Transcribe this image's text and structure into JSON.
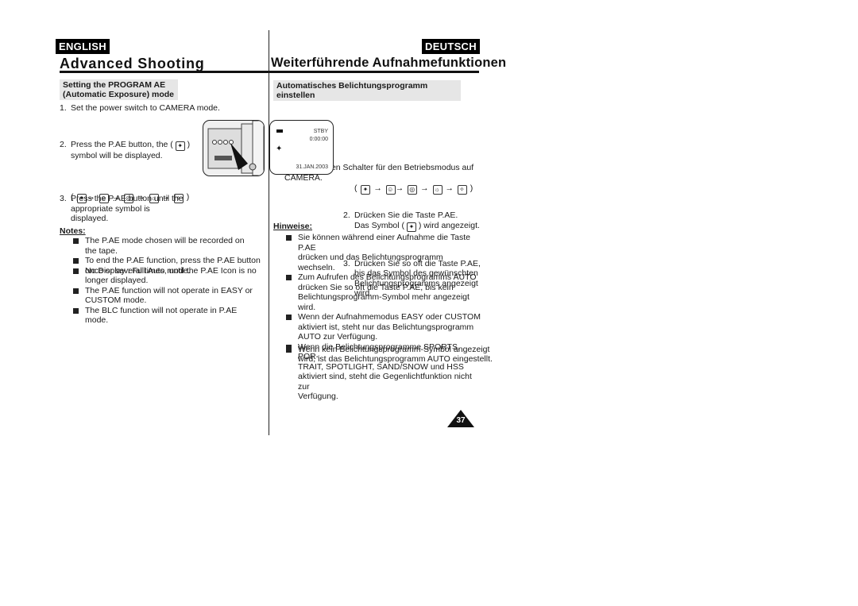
{
  "header": {
    "left_lang": "ENGLISH",
    "right_lang": "DEUTSCH",
    "left_title": "Advanced Shooting",
    "right_title": "Weiterführende Aufnahmefunktionen"
  },
  "english": {
    "section_title_line1": "Setting the PROGRAM AE",
    "section_title_line2": "(Automatic Exposure) mode",
    "steps": [
      {
        "num": "1.",
        "lines": [
          "Set the power switch to CAMERA mode."
        ]
      },
      {
        "num": "2.",
        "lines": [
          "Press the P.AE button, the (",
          ")",
          "symbol will be displayed."
        ]
      },
      {
        "num": "3.",
        "lines": [
          "Press the P.AE button until the",
          "appropriate symbol is",
          "displayed."
        ]
      }
    ],
    "sequence_open": "(",
    "sequence_close": ")",
    "arrow": "→",
    "no_display": "No Display : Full Auto mode.",
    "notes_heading": "Notes:",
    "notes": [
      [
        "The P.AE mode chosen will be recorded on",
        "the tape."
      ],
      [
        "To end the P.AE function, press the P.AE button",
        "once or several times, until the P.AE Icon is no",
        "longer displayed."
      ],
      [
        "The P.AE function will not operate in EASY or",
        "CUSTOM mode."
      ],
      [
        "The BLC function will not operate in P.AE mode."
      ]
    ]
  },
  "deutsch": {
    "section_title": "Automatisches Belichtungsprogramm einstellen",
    "steps": [
      {
        "num": "1.",
        "lines": [
          "Stellen Sie den Schalter für den Betriebsmodus auf",
          "CAMERA."
        ]
      },
      {
        "num": "2.",
        "lines": [
          "Drücken Sie die Taste P.AE.",
          "Das Symbol (",
          ") wird angezeigt."
        ]
      },
      {
        "num": "3.",
        "lines": [
          "Drücken Sie so oft die Taste P.AE,",
          "bis das Symbol des gewünschten",
          "Belichtungsprogramms angezeigt",
          "wird."
        ]
      }
    ],
    "no_display": [
      "Wenn kein Belichtungsprogramm-Symbol angezeigt",
      "wird, ist das Belichtungsprogramm AUTO eingestellt."
    ],
    "notes_heading": "Hinweise:",
    "notes": [
      [
        "Sie können während einer Aufnahme die Taste P.AE",
        "drücken und das Belichtungsprogramm wechseln."
      ],
      [
        "Zum Aufrufen des Belichtungsprogramms AUTO",
        "drücken Sie so oft die Taste P.AE, bis kein",
        "Belichtungsprogramm-Symbol mehr angezeigt wird."
      ],
      [
        "Wenn der Aufnahmemodus EASY oder CUSTOM",
        "aktiviert ist, steht nur das Belichtungsprogramm",
        "AUTO zur Verfügung."
      ],
      [
        "Wenn die Belichtungsprogramme SPORTS, POR-",
        "TRAIT, SPOTLIGHT, SAND/SNOW und HSS",
        "aktiviert sind, steht die Gegenlichtfunktion nicht zur",
        "Verfügung."
      ]
    ]
  },
  "lcd": {
    "status": "STBY",
    "timecode": "0:00:00",
    "date": "31.JAN.2003"
  },
  "icons": [
    "sports-icon",
    "portrait-icon",
    "spotlight-icon",
    "sand-snow-icon",
    "hss-icon"
  ],
  "page_number": "37"
}
